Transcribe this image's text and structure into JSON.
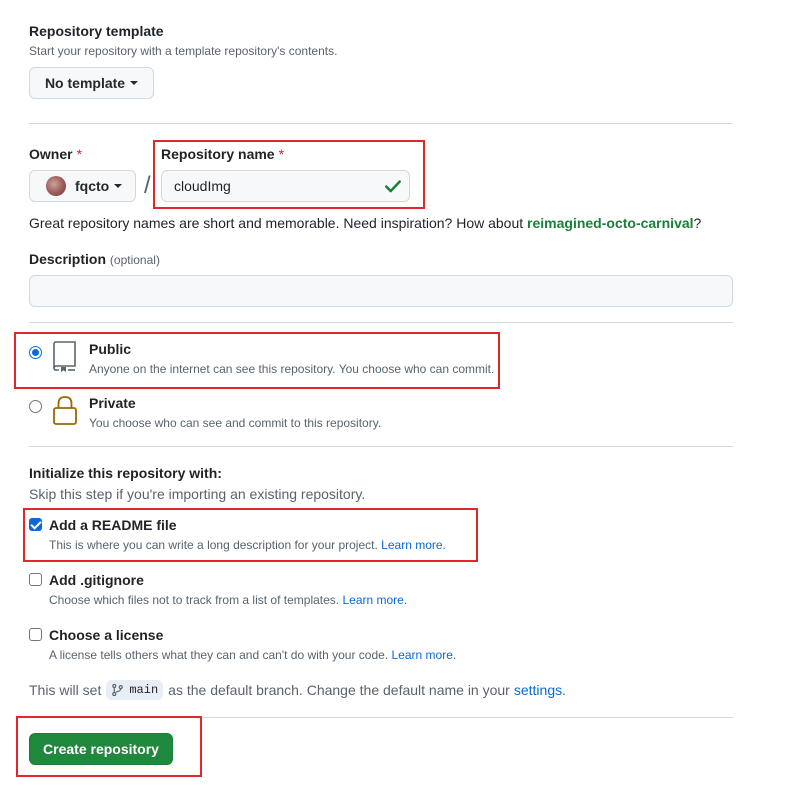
{
  "template": {
    "label": "Repository template",
    "description": "Start your repository with a template repository's contents.",
    "button": "No template"
  },
  "owner": {
    "label": "Owner",
    "required": "*",
    "name": "fqcto"
  },
  "separator": "/",
  "repo_name": {
    "label": "Repository name",
    "required": "*",
    "value": "cloudImg"
  },
  "suggestion": {
    "prefix": "Great repository names are short and memorable. Need inspiration? How about ",
    "name": "reimagined-octo-carnival",
    "suffix": "?"
  },
  "description": {
    "label": "Description",
    "optional": "(optional)",
    "value": ""
  },
  "visibility": {
    "public": {
      "title": "Public",
      "desc": "Anyone on the internet can see this repository. You choose who can commit.",
      "checked": true
    },
    "private": {
      "title": "Private",
      "desc": "You choose who can see and commit to this repository.",
      "checked": false
    }
  },
  "init": {
    "title": "Initialize this repository with:",
    "subtitle": "Skip this step if you're importing an existing repository.",
    "readme": {
      "title": "Add a README file",
      "desc": "This is where you can write a long description for your project.",
      "link": "Learn more.",
      "checked": true
    },
    "gitignore": {
      "title": "Add .gitignore",
      "desc": "Choose which files not to track from a list of templates.",
      "link": "Learn more.",
      "checked": false
    },
    "license": {
      "title": "Choose a license",
      "desc": "A license tells others what they can and can't do with your code.",
      "link": "Learn more.",
      "checked": false
    }
  },
  "default_branch": {
    "prefix": "This will set",
    "branch": "main",
    "middle": "as the default branch. Change the default name in your",
    "link": "settings",
    "suffix": "."
  },
  "create_button": "Create repository",
  "colors": {
    "accent": "#0969da",
    "success": "#1a7f37",
    "primary_button": "#1f883d",
    "annotation": "#e3262b"
  }
}
